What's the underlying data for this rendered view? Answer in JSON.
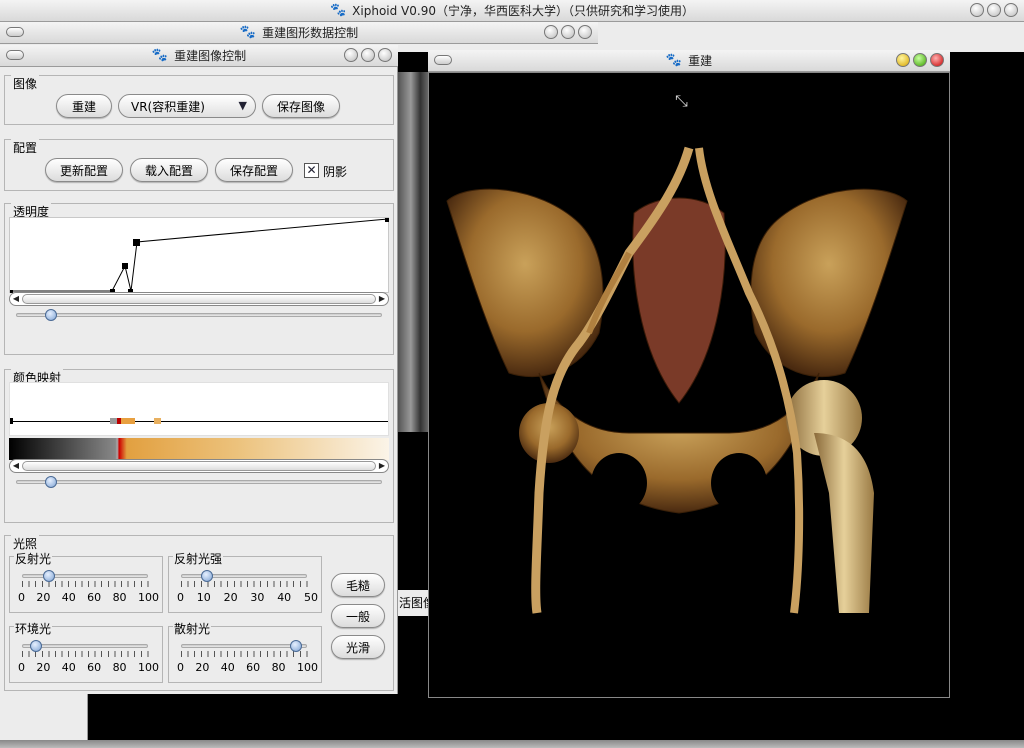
{
  "main_window": {
    "title": "Xiphoid V0.90（宁净，华西医科大学）（只供研究和学习使用）"
  },
  "data_window": {
    "title": "重建图形数据控制"
  },
  "control_window": {
    "title": "重建图像控制",
    "image_group": {
      "title": "图像",
      "rebuild_label": "重建",
      "mode_value": "VR(容积重建)",
      "save_image_label": "保存图像"
    },
    "config_group": {
      "title": "配置",
      "update_label": "更新配置",
      "load_label": "载入配置",
      "save_label": "保存配置",
      "shadow_label": "阴影",
      "shadow_checked": true
    },
    "opacity_group": {
      "title": "透明度"
    },
    "colormap_group": {
      "title": "颜色映射"
    },
    "lighting_group": {
      "title": "光照",
      "reflect": {
        "label": "反射光",
        "scale": [
          "0",
          "20",
          "40",
          "60",
          "80",
          "100"
        ],
        "value_percent": 20
      },
      "reflect_strength": {
        "label": "反射光强",
        "scale": [
          "0",
          "10",
          "20",
          "30",
          "40",
          "50"
        ],
        "value": 10
      },
      "ambient": {
        "label": "环境光",
        "scale": [
          "0",
          "20",
          "40",
          "60",
          "80",
          "100"
        ],
        "value_percent": 10
      },
      "diffuse": {
        "label": "散射光",
        "scale": [
          "0",
          "20",
          "40",
          "60",
          "80",
          "100"
        ],
        "value_percent": 90
      },
      "rough_label": "毛糙",
      "normal_label": "一般",
      "smooth_label": "光滑"
    }
  },
  "render_window": {
    "title": "重建"
  },
  "background": {
    "partial_label": "活图像"
  }
}
